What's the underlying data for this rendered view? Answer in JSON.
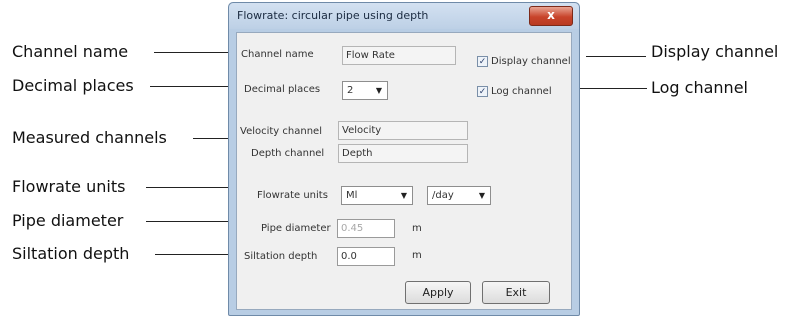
{
  "dialog": {
    "title": "Flowrate: circular pipe using depth",
    "close_glyph": "x",
    "channel_name_label": "Channel name",
    "channel_name_value": "Flow Rate",
    "decimal_places_label": "Decimal places",
    "decimal_places_value": "2",
    "display_channel_label": "Display channel",
    "display_channel_checked": true,
    "log_channel_label": "Log channel",
    "log_channel_checked": true,
    "velocity_channel_label": "Velocity channel",
    "velocity_channel_value": "Velocity",
    "depth_channel_label": "Depth channel",
    "depth_channel_value": "Depth",
    "flowrate_units_label": "Flowrate units",
    "flowrate_units_value": "Ml",
    "flowrate_period_value": "/day",
    "pipe_diameter_label": "Pipe diameter",
    "pipe_diameter_value": "0.45",
    "pipe_diameter_unit": "m",
    "siltation_depth_label": "Siltation depth",
    "siltation_depth_value": "0.0",
    "siltation_depth_unit": "m",
    "apply_label": "Apply",
    "exit_label": "Exit",
    "check_glyph": "✓",
    "dropdown_glyph": "▼"
  },
  "callouts": {
    "channel_name": "Channel name",
    "decimal_places": "Decimal places",
    "measured_channels": "Measured channels",
    "flowrate_units": "Flowrate units",
    "pipe_diameter": "Pipe diameter",
    "siltation_depth": "Siltation depth",
    "display_channel": "Display channel",
    "log_channel": "Log channel"
  }
}
